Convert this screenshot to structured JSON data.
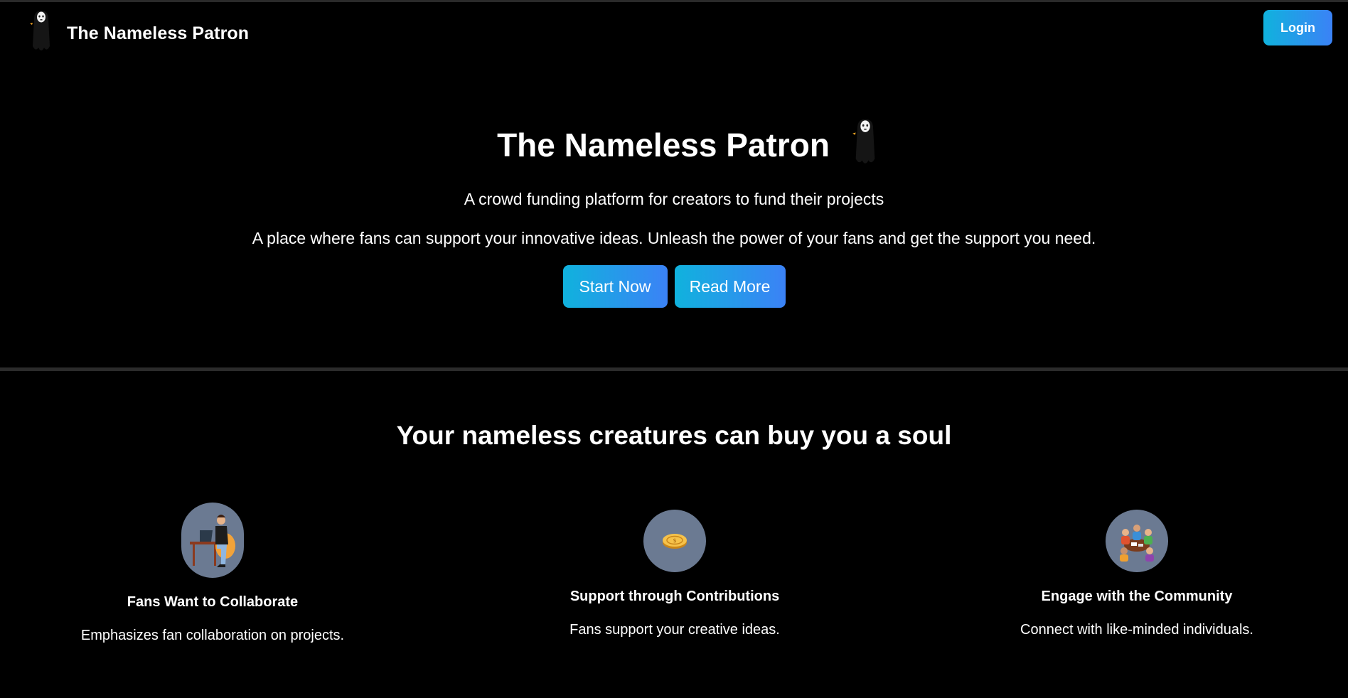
{
  "colors": {
    "background": "#000000",
    "button_gradient_start": "#10b2dd",
    "button_gradient_end": "#3b82f6",
    "icon_circle": "#6b7a92",
    "divider": "#2b2b2b"
  },
  "navbar": {
    "logo_icon": "no-face-spirit-icon",
    "brand_title": "The Nameless Patron",
    "login_label": "Login"
  },
  "hero": {
    "title": "The Nameless Patron",
    "title_icon": "no-face-spirit-icon",
    "subtitle": "A crowd funding platform for creators to fund their projects",
    "description": "A place where fans can support your innovative ideas. Unleash the power of your fans and get the support you need.",
    "start_label": "Start Now",
    "read_more_label": "Read More"
  },
  "features_section": {
    "title": "Your nameless creatures can buy you a soul",
    "items": [
      {
        "icon": "person-at-laptop-icon",
        "title": "Fans Want to Collaborate",
        "description": "Emphasizes fan collaboration on projects."
      },
      {
        "icon": "coin-icon",
        "title": "Support through Contributions",
        "description": "Fans support your creative ideas."
      },
      {
        "icon": "community-group-icon",
        "title": "Engage with the Community",
        "description": "Connect with like-minded individuals."
      }
    ]
  }
}
